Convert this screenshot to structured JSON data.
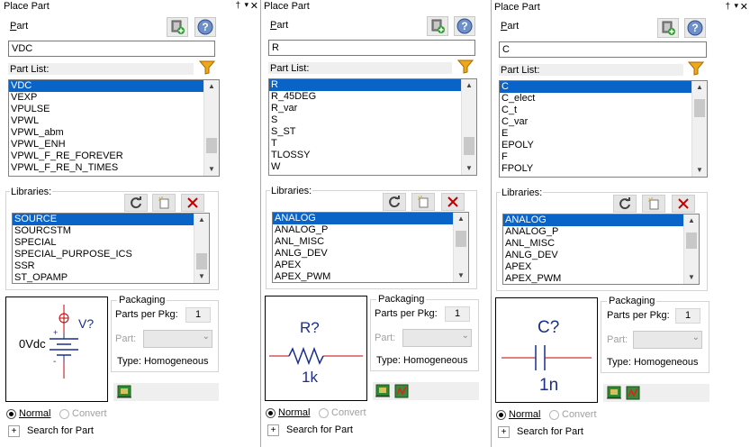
{
  "common": {
    "title": "Place Part",
    "pin": "†",
    "dropdown": "▾",
    "close": "✕",
    "part_label_u": "P",
    "part_label_rest": "art",
    "partlist_label": "Part List:",
    "libraries_label": "Libraries:",
    "packaging_label": "Packaging",
    "parts_per_pkg_label": "Parts per Pkg:",
    "parts_per_pkg_value": "1",
    "part_field_label": "Part:",
    "type_label": "Type:",
    "type_value": "Homogeneous",
    "normal_label": "Normal",
    "convert_label": "Convert",
    "search_label": "Search for Part",
    "plus": "+",
    "colors": {
      "selection": "#0a64c8",
      "symbol": "#1a2e8c",
      "red": "#c00000"
    }
  },
  "panels": [
    {
      "part_value": "VDC",
      "parts": [
        "VDC",
        "VEXP",
        "VPULSE",
        "VPWL",
        "VPWL_abm",
        "VPWL_ENH",
        "VPWL_F_RE_FOREVER",
        "VPWL_F_RE_N_TIMES"
      ],
      "libraries": [
        "SOURCE",
        "SOURCSTM",
        "SPECIAL",
        "SPECIAL_PURPOSE_ICS",
        "SSR",
        "ST_OPAMP"
      ],
      "symbol": {
        "ref": "V?",
        "value": "0Vdc"
      }
    },
    {
      "part_value": "R",
      "parts": [
        "R",
        "R_45DEG",
        "R_var",
        "S",
        "S_ST",
        "T",
        "TLOSSY",
        "W"
      ],
      "libraries": [
        "ANALOG",
        "ANALOG_P",
        "ANL_MISC",
        "ANLG_DEV",
        "APEX",
        "APEX_PWM"
      ],
      "symbol": {
        "ref": "R?",
        "value": "1k"
      }
    },
    {
      "part_value": "C",
      "parts": [
        "C",
        "C_elect",
        "C_t",
        "C_var",
        "E",
        "EPOLY",
        "F",
        "FPOLY"
      ],
      "libraries": [
        "ANALOG",
        "ANALOG_P",
        "ANL_MISC",
        "ANLG_DEV",
        "APEX",
        "APEX_PWM"
      ],
      "symbol": {
        "ref": "C?",
        "value": "1n"
      }
    }
  ]
}
